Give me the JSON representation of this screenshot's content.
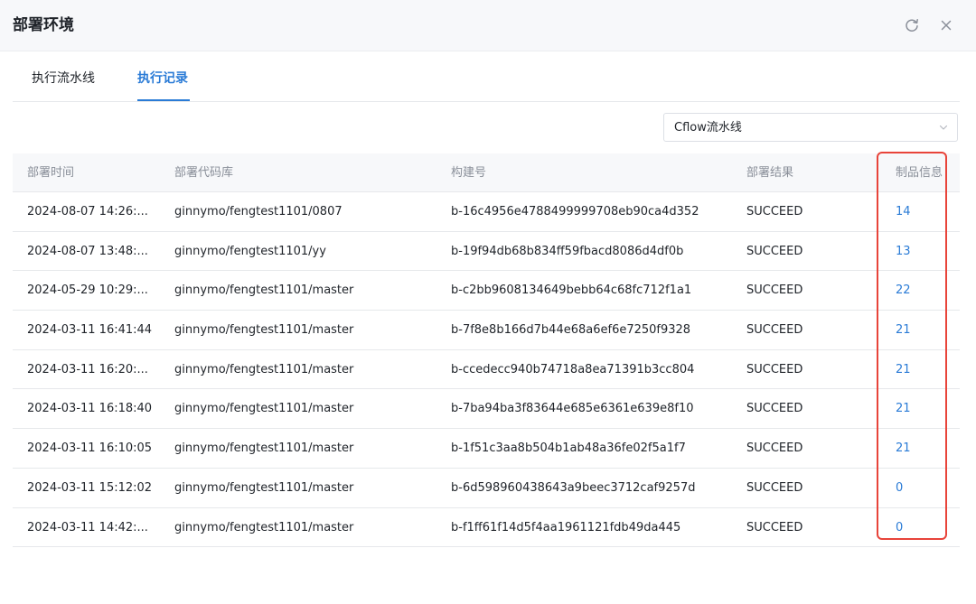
{
  "dialog": {
    "title": "部署环境",
    "refresh_icon": "refresh-icon",
    "close_icon": "close-icon"
  },
  "tabs": [
    {
      "label": "执行流水线",
      "active": false
    },
    {
      "label": "执行记录",
      "active": true
    }
  ],
  "filter": {
    "selected": "Cflow流水线",
    "icon": "chevron-down-icon"
  },
  "table": {
    "columns": [
      "部署时间",
      "部署代码库",
      "构建号",
      "部署结果",
      "制品信息"
    ],
    "rows": [
      {
        "time": "2024-08-07 14:26:...",
        "repo": "ginnymo/fengtest1101/0807",
        "build": "b-16c4956e4788499999708eb90ca4d352",
        "result": "SUCCEED",
        "artifact": "14"
      },
      {
        "time": "2024-08-07 13:48:...",
        "repo": "ginnymo/fengtest1101/yy",
        "build": "b-19f94db68b834ff59fbacd8086d4df0b",
        "result": "SUCCEED",
        "artifact": "13"
      },
      {
        "time": "2024-05-29 10:29:...",
        "repo": "ginnymo/fengtest1101/master",
        "build": "b-c2bb9608134649bebb64c68fc712f1a1",
        "result": "SUCCEED",
        "artifact": "22"
      },
      {
        "time": "2024-03-11 16:41:44",
        "repo": "ginnymo/fengtest1101/master",
        "build": "b-7f8e8b166d7b44e68a6ef6e7250f9328",
        "result": "SUCCEED",
        "artifact": "21"
      },
      {
        "time": "2024-03-11 16:20:...",
        "repo": "ginnymo/fengtest1101/master",
        "build": "b-ccedecc940b74718a8ea71391b3cc804",
        "result": "SUCCEED",
        "artifact": "21"
      },
      {
        "time": "2024-03-11 16:18:40",
        "repo": "ginnymo/fengtest1101/master",
        "build": "b-7ba94ba3f83644e685e6361e639e8f10",
        "result": "SUCCEED",
        "artifact": "21"
      },
      {
        "time": "2024-03-11 16:10:05",
        "repo": "ginnymo/fengtest1101/master",
        "build": "b-1f51c3aa8b504b1ab48a36fe02f5a1f7",
        "result": "SUCCEED",
        "artifact": "21"
      },
      {
        "time": "2024-03-11 15:12:02",
        "repo": "ginnymo/fengtest1101/master",
        "build": "b-6d598960438643a9beec3712caf9257d",
        "result": "SUCCEED",
        "artifact": "0"
      },
      {
        "time": "2024-03-11 14:42:...",
        "repo": "ginnymo/fengtest1101/master",
        "build": "b-f1ff61f14d5f4aa1961121fdb49da445",
        "result": "SUCCEED",
        "artifact": "0"
      }
    ]
  },
  "colors": {
    "accent": "#2a7bd6",
    "highlight": "#e8443a",
    "header_bg": "#f7f8fa"
  }
}
